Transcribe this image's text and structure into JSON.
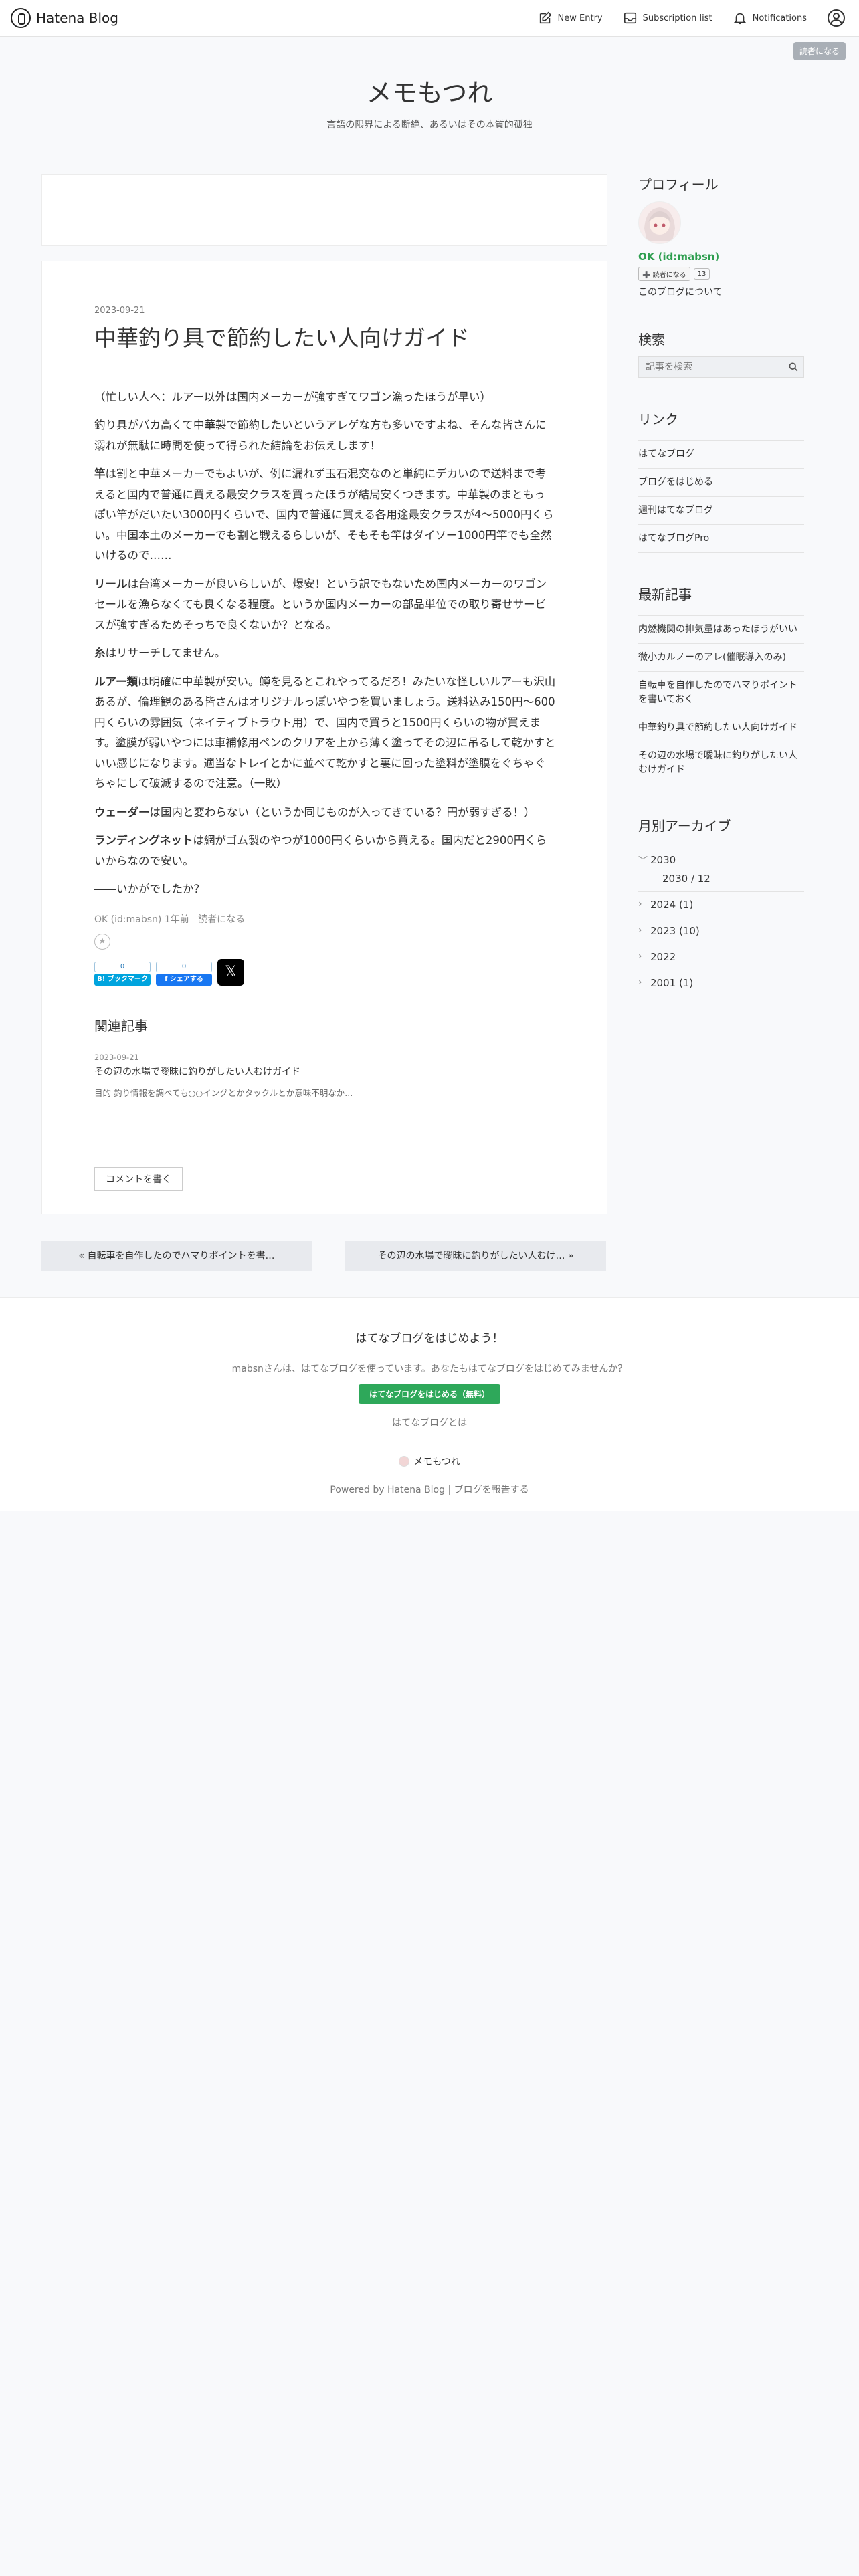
{
  "topbar": {
    "logo": "Hatena Blog",
    "new_entry": "New Entry",
    "subscription_list": "Subscription list",
    "notifications": "Notifications",
    "reader_badge": "読者になる"
  },
  "header": {
    "title": "メモもつれ",
    "description": "言語の限界による断絶、あるいはその本質的孤独"
  },
  "entry": {
    "date": "2023-09-21",
    "title": "中華釣り具で節約したい人向けガイド",
    "p0": "（忙しい人へ：ルアー以外は国内メーカーが強すぎてワゴン漁ったほうが早い）",
    "p1": "釣り具がバカ高くて中華製で節約したいというアレゲな方も多いですよね、そんな皆さんに溺れが無駄に時間を使って得られた結論をお伝えします！",
    "p2_bold": "竿",
    "p2": "は割と中華メーカーでもよいが、例に漏れず玉石混交なのと単純にデカいので送料まで考えると国内で普通に買える最安クラスを買ったほうが結局安くつきます。中華製のまともっぽい竿がだいたい3000円くらいで、国内で普通に買える各用途最安クラスが4〜5000円くらい。中国本土のメーカーでも割と戦えるらしいが、そもそも竿はダイソー1000円竿でも全然いけるので……",
    "p3_bold": "リール",
    "p3": "は台湾メーカーが良いらしいが、爆安！という訳でもないため国内メーカーのワゴンセールを漁らなくても良くなる程度。というか国内メーカーの部品単位での取り寄せサービスが強すぎるためそっちで良くないか？となる。",
    "p4_bold": "糸",
    "p4": "はリサーチしてません。",
    "p5_bold": "ルアー類",
    "p5": "は明確に中華製が安い。鱒を見るとこれやってるだろ！みたいな怪しいルアーも沢山あるが、倫理観のある皆さんはオリジナルっぽいやつを買いましょう。送料込み150円〜600円くらいの雰囲気（ネイティブトラウト用）で、国内で買うと1500円くらいの物が買えます。塗膜が弱いやつには車補修用ペンのクリアを上から薄く塗ってその辺に吊るして乾かすといい感じになります。適当なトレイとかに並べて乾かすと裏に回った塗料が塗膜をぐちゃぐちゃにして破滅するので注意。（一敗）",
    "p6_bold": "ウェーダー",
    "p6": "は国内と変わらない（というか同じものが入ってきている？円が弱すぎる！）",
    "p7_bold": "ランディングネット",
    "p7": "は網がゴム製のやつが1000円くらいから買える。国内だと2900円くらいからなので安い。",
    "p8": "――いかがでしたか？",
    "author": "OK (id:mabsn)",
    "time": "1年前",
    "subscribe": "読者になる",
    "bookmark_count": "0",
    "bookmark_label": "B! ブックマーク",
    "share_count": "0",
    "share_label": "f シェアする",
    "x_label": "𝕏"
  },
  "related": {
    "heading": "関連記事",
    "date": "2023-09-21",
    "title": "その辺の水場で曖昧に釣りがしたい人むけガイド",
    "snippet": "目的 釣り情報を調べても○○イングとかタックルとか意味不明なか..."
  },
  "comment_button": "コメントを書く",
  "pager": {
    "prev": "« 自転車を自作したのでハマりポイントを書…",
    "next": "その辺の水場で曖昧に釣りがしたい人むけ… »"
  },
  "sidebar": {
    "profile_heading": "プロフィール",
    "profile_name": "OK (id:mabsn)",
    "subscribe_btn": "➕ 読者になる",
    "subscribe_count": "13",
    "about": "このブログについて",
    "search_heading": "検索",
    "search_placeholder": "記事を検索",
    "links_heading": "リンク",
    "links": [
      "はてなブログ",
      "ブログをはじめる",
      "週刊はてなブログ",
      "はてなブログPro"
    ],
    "recent_heading": "最新記事",
    "recent": [
      "内燃機関の排気量はあったほうがいい",
      "微小カルノーのアレ(催眠導入のみ)",
      "自転車を自作したのでハマりポイントを書いておく",
      "中華釣り具で節約したい人向けガイド",
      "その辺の水場で曖昧に釣りがしたい人むけガイド"
    ],
    "archive_heading": "月別アーカイブ",
    "archive": [
      "2030",
      "2030 / 12",
      "2024 (1)",
      "2023 (10)",
      "2022",
      "2001 (1)"
    ]
  },
  "footer": {
    "heading": "はてなブログをはじめよう！",
    "text": "mabsnさんは、はてなブログを使っています。あなたもはてなブログをはじめてみませんか？",
    "start_button": "はてなブログをはじめる（無料）",
    "about": "はてなブログとは",
    "blog_name": "メモもつれ",
    "powered": "Powered by Hatena Blog | ブログを報告する"
  }
}
